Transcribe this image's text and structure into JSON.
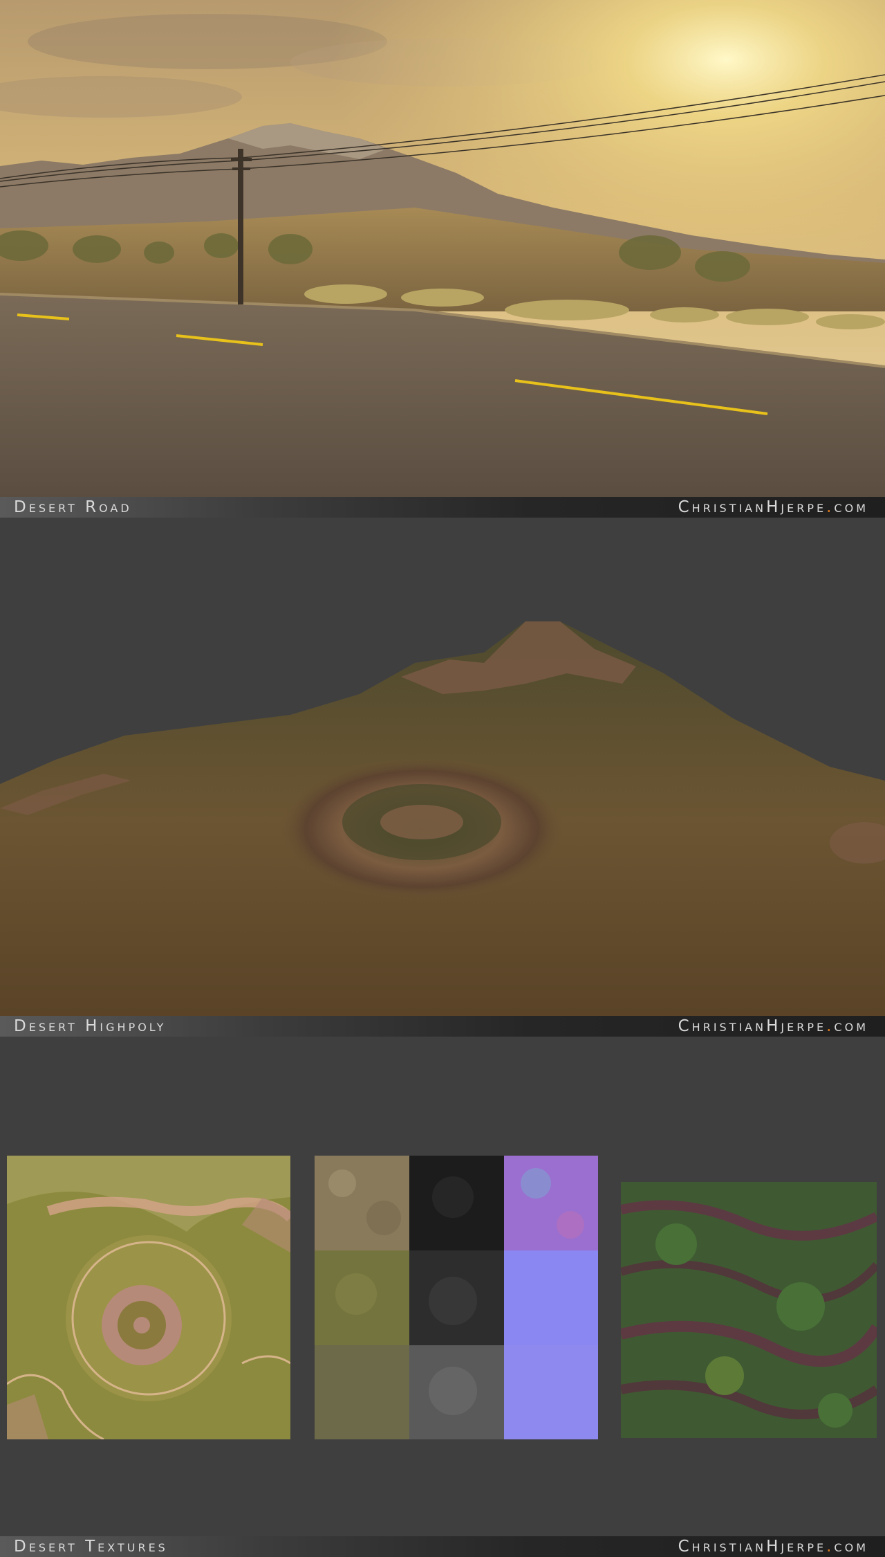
{
  "sections": [
    {
      "caption": "Desert Road",
      "site_name": "ChristianHjerpe",
      "site_dot": ".",
      "site_tld": "com"
    },
    {
      "caption": "Desert Highpoly",
      "site_name": "ChristianHjerpe",
      "site_dot": ".",
      "site_tld": "com"
    },
    {
      "caption": "Desert Textures",
      "site_name": "ChristianHjerpe",
      "site_dot": ".",
      "site_tld": "com"
    }
  ],
  "colors": {
    "background": "#3f3f3f",
    "accent_dot": "#e07a1a",
    "road_line": "#e8c21a",
    "sky": "#d9b36a",
    "terrain": "#6f5a35"
  }
}
